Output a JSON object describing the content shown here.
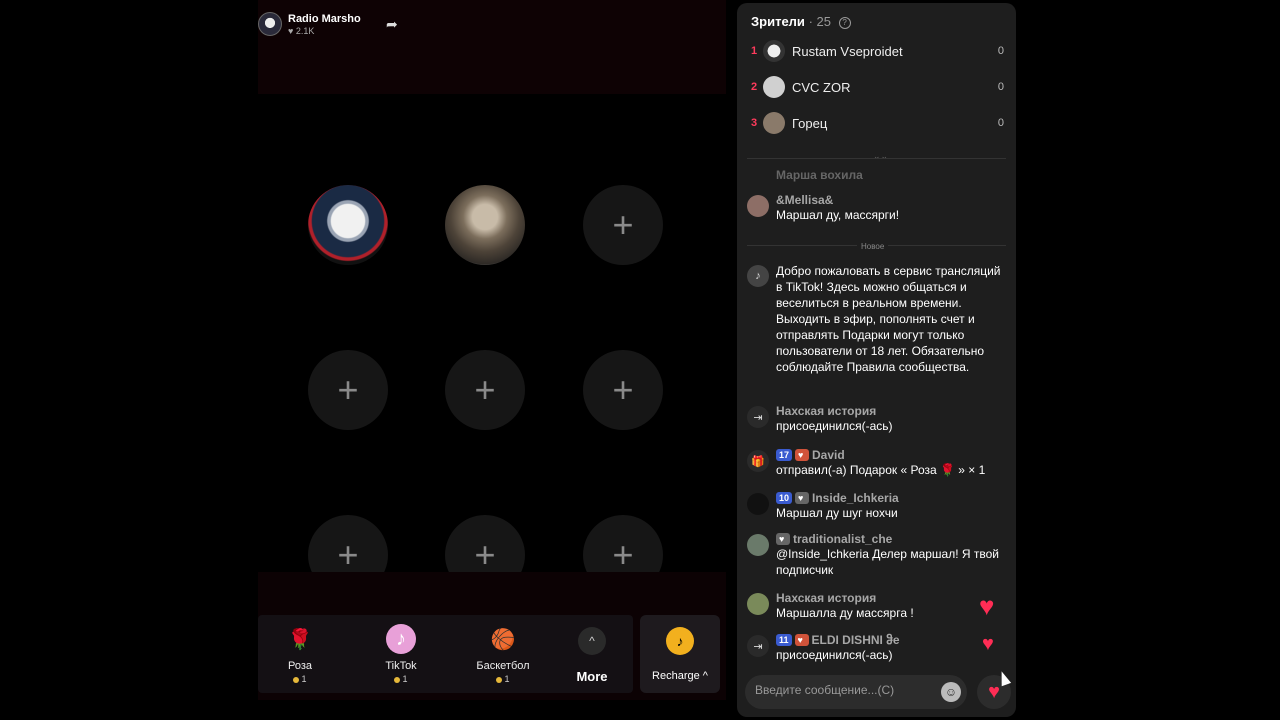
{
  "host": {
    "name": "Radio Marsho",
    "likes": "♥ 2.1K"
  },
  "share_icon": "share-arrow-icon",
  "seats": [
    {
      "type": "user",
      "avatar": "seal"
    },
    {
      "type": "user",
      "avatar": "wolf"
    },
    {
      "type": "empty",
      "symbol": "+"
    },
    {
      "type": "empty",
      "symbol": "+"
    },
    {
      "type": "empty",
      "symbol": "+"
    },
    {
      "type": "empty",
      "symbol": "+"
    },
    {
      "type": "empty",
      "symbol": "+"
    },
    {
      "type": "empty",
      "symbol": "+"
    },
    {
      "type": "empty",
      "symbol": "+"
    }
  ],
  "gifts": [
    {
      "name": "Роза",
      "price": "1",
      "icon": "🌹"
    },
    {
      "name": "TikTok",
      "price": "1",
      "icon": "♪"
    },
    {
      "name": "Баскетбол",
      "price": "1",
      "icon": "🏀"
    }
  ],
  "more": {
    "label": "More",
    "icon": "^"
  },
  "recharge": {
    "label": "Recharge ^",
    "icon": "♪"
  },
  "viewers": {
    "title": "Зрители",
    "count": "· 25",
    "list": [
      {
        "rank": "1",
        "name": "Rustam Vseproidet",
        "score": "0"
      },
      {
        "rank": "2",
        "name": "CVC ZOR",
        "score": "0"
      },
      {
        "rank": "3",
        "name": "Горец",
        "score": "0"
      }
    ]
  },
  "chat": {
    "faded_message": "Марша вохила",
    "new_separator": "Новое",
    "messages": [
      {
        "user": "&Mellisa&",
        "text": "Маршал ду, массярги!"
      },
      {
        "user": "",
        "text": "Добро пожаловать в сервис трансляций в TikTok! Здесь можно общаться и веселиться в реальном времени. Выходить в эфир, пополнять счет и отправлять Подарки могут только пользователи от 18 лет. Обязательно соблюдайте Правила сообщества."
      },
      {
        "user": "Нахская история",
        "text": " присоединился(-ась)"
      },
      {
        "user": "David",
        "level": "17",
        "text": "отправил(-а) Подарок « Роза 🌹 » × 1"
      },
      {
        "user": "Inside_Ichkeria",
        "level": "10",
        "text": "Маршал ду шуг нохчи"
      },
      {
        "user": "traditionalist_che",
        "text": "@Inside_Ichkeria Делер маршал! Я твой подписчик"
      },
      {
        "user": "Нахская история",
        "text": "Маршалла ду массярга !"
      },
      {
        "user": "ELDI DISHNI ჵe",
        "level": "11",
        "text": " присоединился(-ась)"
      }
    ]
  },
  "input": {
    "placeholder": "Введите сообщение...(C)"
  }
}
